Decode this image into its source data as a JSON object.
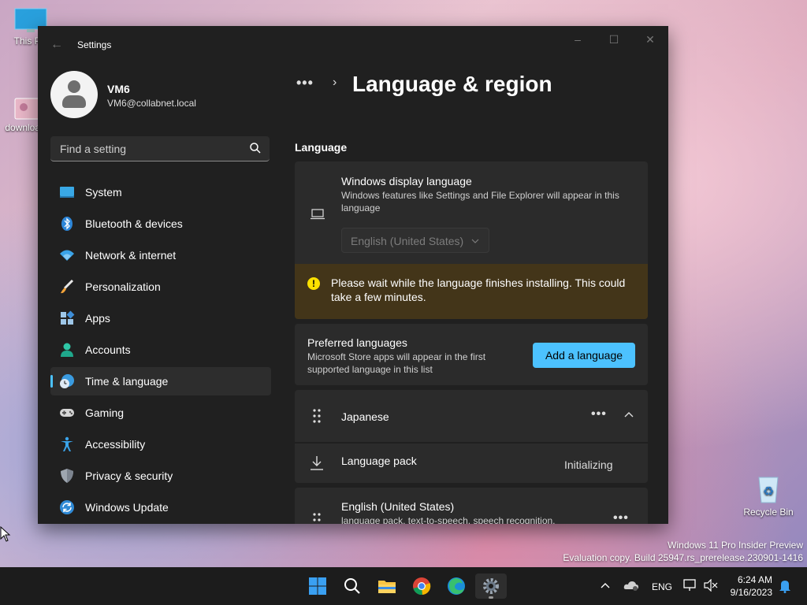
{
  "desktop": {
    "icons": [
      {
        "label": "This PC",
        "icon": "monitor-icon"
      },
      {
        "label": "downloads",
        "icon": "folder-image-icon"
      },
      {
        "label": "Recycle Bin",
        "icon": "recycle-bin-icon"
      }
    ],
    "watermark": {
      "line1": "Windows 11 Pro Insider Preview",
      "line2": "Evaluation copy. Build 25947.rs_prerelease.230901-1416"
    }
  },
  "window": {
    "title": "Settings",
    "controls": {
      "minimize": "–",
      "maximize": "☐",
      "close": "✕"
    }
  },
  "user": {
    "name": "VM6",
    "email": "VM6@collabnet.local"
  },
  "search": {
    "placeholder": "Find a setting"
  },
  "sidebar": {
    "items": [
      {
        "label": "System",
        "icon": "system-icon"
      },
      {
        "label": "Bluetooth & devices",
        "icon": "bluetooth-icon"
      },
      {
        "label": "Network & internet",
        "icon": "wifi-icon"
      },
      {
        "label": "Personalization",
        "icon": "brush-icon"
      },
      {
        "label": "Apps",
        "icon": "apps-icon"
      },
      {
        "label": "Accounts",
        "icon": "accounts-icon"
      },
      {
        "label": "Time & language",
        "icon": "time-language-icon",
        "active": true
      },
      {
        "label": "Gaming",
        "icon": "gamepad-icon"
      },
      {
        "label": "Accessibility",
        "icon": "accessibility-icon"
      },
      {
        "label": "Privacy & security",
        "icon": "shield-icon"
      },
      {
        "label": "Windows Update",
        "icon": "update-icon"
      }
    ]
  },
  "content": {
    "breadcrumb_more": "•••",
    "breadcrumb_sep": "›",
    "page_title": "Language & region",
    "section_title": "Language",
    "display_language": {
      "title": "Windows display language",
      "description": "Windows features like Settings and File Explorer will appear in this language",
      "selected": "English (United States)"
    },
    "warning": {
      "icon": "!",
      "text": "Please wait while the language finishes installing. This could take a few minutes."
    },
    "preferred": {
      "title": "Preferred languages",
      "description": "Microsoft Store apps will appear in the first supported language in this list",
      "button": "Add a language"
    },
    "languages": [
      {
        "name": "Japanese",
        "more": "•••",
        "subitem": {
          "label": "Language pack",
          "status": "Initializing"
        }
      },
      {
        "name": "English (United States)",
        "description": "language pack, text-to-speech, speech recognition, handwriting, basic typing",
        "more": "•••"
      }
    ]
  },
  "taskbar": {
    "apps": [
      "start-icon",
      "search-icon",
      "file-explorer-icon",
      "chrome-icon",
      "edge-icon",
      "settings-icon"
    ],
    "tray": {
      "language": "ENG",
      "time": "6:24 AM",
      "date": "9/16/2023"
    }
  },
  "colors": {
    "accent": "#4cc2ff",
    "window_bg": "#202020",
    "card_bg": "#2b2b2b",
    "warning_bg": "#433519",
    "warning_icon": "#fce100"
  }
}
